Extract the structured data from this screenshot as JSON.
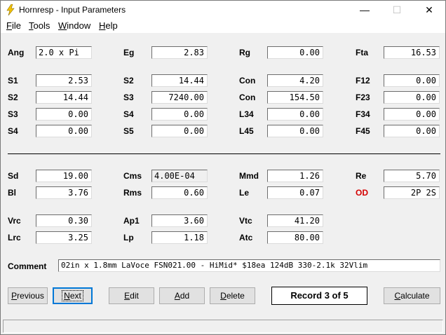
{
  "window": {
    "title": "Hornresp - Input Parameters",
    "minimize_glyph": "—",
    "maximize_glyph": "☐",
    "close_glyph": "✕",
    "icon": "lightning-bolt-icon",
    "accent_color": "#f5c400"
  },
  "menu": [
    {
      "key": "F",
      "rest": "ile"
    },
    {
      "key": "T",
      "rest": "ools"
    },
    {
      "key": "W",
      "rest": "indow"
    },
    {
      "key": "H",
      "rest": "elp"
    }
  ],
  "params": {
    "ang": {
      "label": "Ang",
      "value": "2.0 x Pi"
    },
    "eg": {
      "label": "Eg",
      "value": "2.83"
    },
    "rg": {
      "label": "Rg",
      "value": "0.00"
    },
    "fta": {
      "label": "Fta",
      "value": "16.53"
    },
    "s1": {
      "label": "S1",
      "value": "2.53"
    },
    "s2a": {
      "label": "S2",
      "value": "14.44"
    },
    "con1": {
      "label": "Con",
      "value": "4.20"
    },
    "f12": {
      "label": "F12",
      "value": "0.00"
    },
    "s2b": {
      "label": "S2",
      "value": "14.44"
    },
    "s3a": {
      "label": "S3",
      "value": "7240.00"
    },
    "con2": {
      "label": "Con",
      "value": "154.50"
    },
    "f23": {
      "label": "F23",
      "value": "0.00"
    },
    "s3b": {
      "label": "S3",
      "value": "0.00"
    },
    "s4a": {
      "label": "S4",
      "value": "0.00"
    },
    "l34": {
      "label": "L34",
      "value": "0.00"
    },
    "f34": {
      "label": "F34",
      "value": "0.00"
    },
    "s4b": {
      "label": "S4",
      "value": "0.00"
    },
    "s5": {
      "label": "S5",
      "value": "0.00"
    },
    "l45": {
      "label": "L45",
      "value": "0.00"
    },
    "f45": {
      "label": "F45",
      "value": "0.00"
    },
    "sd": {
      "label": "Sd",
      "value": "19.00"
    },
    "cms": {
      "label": "Cms",
      "value": "4.00E-04"
    },
    "mmd": {
      "label": "Mmd",
      "value": "1.26"
    },
    "re": {
      "label": "Re",
      "value": "5.70"
    },
    "bl": {
      "label": "Bl",
      "value": "3.76"
    },
    "rms": {
      "label": "Rms",
      "value": "0.60"
    },
    "le": {
      "label": "Le",
      "value": "0.07"
    },
    "od": {
      "label": "OD",
      "value": "2P 2S"
    },
    "vrc": {
      "label": "Vrc",
      "value": "0.30"
    },
    "ap1": {
      "label": "Ap1",
      "value": "3.60"
    },
    "vtc": {
      "label": "Vtc",
      "value": "41.20"
    },
    "lrc": {
      "label": "Lrc",
      "value": "3.25"
    },
    "lp": {
      "label": "Lp",
      "value": "1.18"
    },
    "atc": {
      "label": "Atc",
      "value": "80.00"
    }
  },
  "comment": {
    "label": "Comment",
    "value": "02in x 1.8mm LaVoce FSN021.00 - HiMid* $18ea 124dB 330-2.1k 32Vlim"
  },
  "buttons": {
    "previous": {
      "key": "P",
      "rest": "revious"
    },
    "next": {
      "key": "N",
      "rest": "ext"
    },
    "edit": {
      "key": "E",
      "rest": "dit"
    },
    "add": {
      "key": "A",
      "rest": "dd"
    },
    "delete": {
      "key": "D",
      "rest": "elete"
    },
    "calculate": {
      "key": "C",
      "rest": "alculate"
    }
  },
  "record": "Record 3 of 5",
  "colors": {
    "od_label": "#d40000",
    "focus_border": "#0078d7"
  }
}
